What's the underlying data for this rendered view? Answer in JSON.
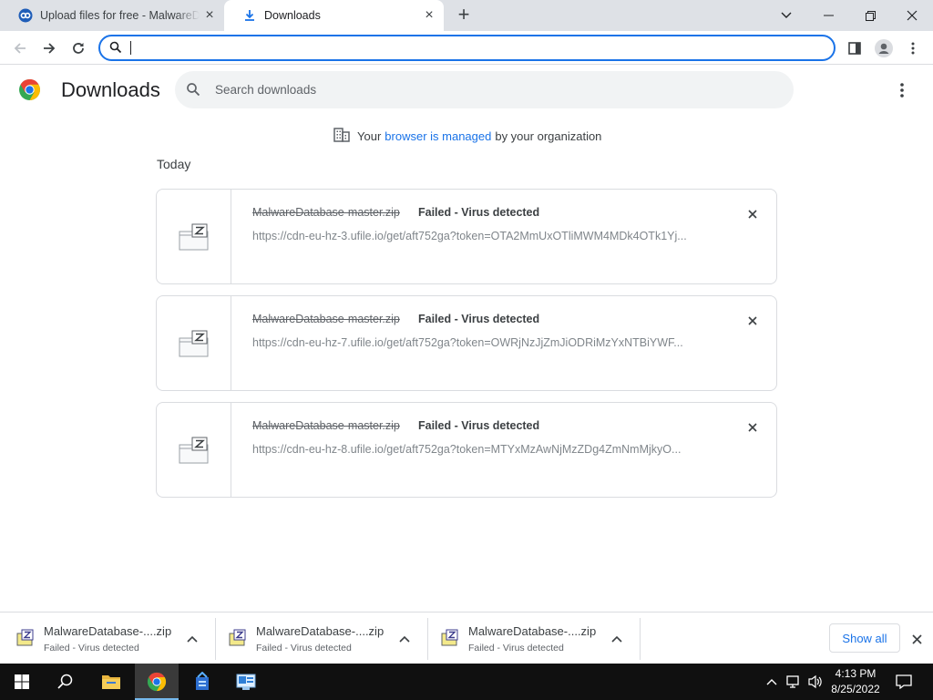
{
  "tabs": [
    {
      "title": "Upload files for free - MalwareDatabase-master.zip - ufile.io",
      "active": false
    },
    {
      "title": "Downloads",
      "active": true
    }
  ],
  "omnibox": {
    "value": "",
    "placeholder": ""
  },
  "page": {
    "title": "Downloads",
    "search_placeholder": "Search downloads",
    "managed_prefix": "Your",
    "managed_link": "browser is managed",
    "managed_suffix": "by your organization",
    "section": "Today"
  },
  "downloads": [
    {
      "file": "MalwareDatabase-master.zip",
      "status": "Failed - Virus detected",
      "url": "https://cdn-eu-hz-3.ufile.io/get/aft752ga?token=OTA2MmUxOTliMWM4MDk4OTk1Yj..."
    },
    {
      "file": "MalwareDatabase-master.zip",
      "status": "Failed - Virus detected",
      "url": "https://cdn-eu-hz-7.ufile.io/get/aft752ga?token=OWRjNzJjZmJiODRiMzYxNTBiYWF..."
    },
    {
      "file": "MalwareDatabase-master.zip",
      "status": "Failed - Virus detected",
      "url": "https://cdn-eu-hz-8.ufile.io/get/aft752ga?token=MTYxMzAwNjMzZDg4ZmNmMjkyO..."
    }
  ],
  "shelf": {
    "items": [
      {
        "name": "MalwareDatabase-....zip",
        "status": "Failed - Virus detected"
      },
      {
        "name": "MalwareDatabase-....zip",
        "status": "Failed - Virus detected"
      },
      {
        "name": "MalwareDatabase-....zip",
        "status": "Failed - Virus detected"
      }
    ],
    "show_all": "Show all"
  },
  "taskbar": {
    "apps": [
      "start-icon",
      "search-icon",
      "file-explorer-icon",
      "chrome-icon",
      "app-icon",
      "control-panel-icon"
    ],
    "time": "4:13 PM",
    "date": "8/25/2022"
  },
  "colors": {
    "accent": "#1a73e8",
    "tabstrip": "#dee1e6",
    "taskbar": "#101010"
  }
}
